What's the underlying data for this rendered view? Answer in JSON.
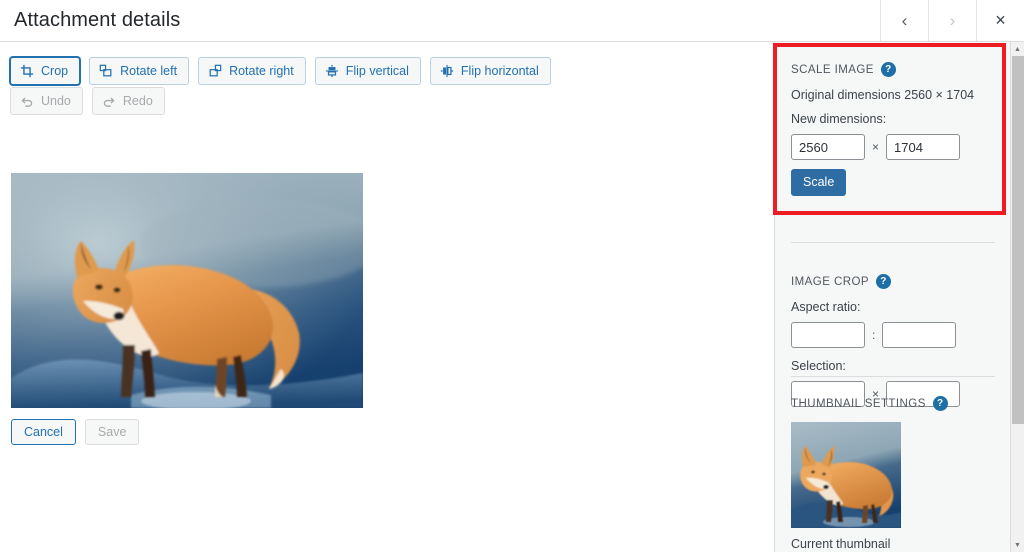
{
  "header": {
    "title": "Attachment details",
    "nav": {
      "prev_label": "‹",
      "prev_name": "previous-attachment",
      "next_label": "›",
      "next_name": "next-attachment",
      "close_label": "×",
      "close_name": "close-dialog"
    }
  },
  "editor": {
    "tools": [
      {
        "label": "Crop",
        "icon": "crop-icon",
        "state": "focused"
      },
      {
        "label": "Rotate left",
        "icon": "rotate-left-icon",
        "state": "enabled"
      },
      {
        "label": "Rotate right",
        "icon": "rotate-right-icon",
        "state": "enabled"
      },
      {
        "label": "Flip vertical",
        "icon": "flip-vertical-icon",
        "state": "enabled"
      },
      {
        "label": "Flip horizontal",
        "icon": "flip-horizontal-icon",
        "state": "enabled"
      }
    ],
    "history": [
      {
        "label": "Undo",
        "icon": "undo-icon",
        "state": "disabled"
      },
      {
        "label": "Redo",
        "icon": "redo-icon",
        "state": "disabled"
      }
    ],
    "image_alt": "Red fox standing on snow at sunset",
    "actions": {
      "cancel_label": "Cancel",
      "save_label": "Save",
      "save_state": "disabled"
    }
  },
  "sidebar": {
    "scale_image": {
      "title": "SCALE IMAGE",
      "help_label": "?",
      "original_dimensions_text": "Original dimensions 2560 × 1704",
      "new_dimensions_label": "New dimensions:",
      "width_value": "2560",
      "height_value": "1704",
      "times_symbol": "×",
      "scale_button_label": "Scale",
      "highlighted": true,
      "highlight_color": "#ee1c25"
    },
    "image_crop": {
      "title": "IMAGE CROP",
      "help_label": "?",
      "aspect_ratio_label": "Aspect ratio:",
      "aspect_width_value": "",
      "aspect_height_value": "",
      "ratio_symbol": ":",
      "selection_label": "Selection:",
      "selection_width_value": "",
      "selection_height_value": "",
      "times_symbol": "×"
    },
    "thumbnail_settings": {
      "title": "THUMBNAIL SETTINGS",
      "help_label": "?",
      "caption": "Current thumbnail"
    }
  },
  "colors": {
    "accent": "#2271b1",
    "primary_button": "#2e6da4",
    "highlight": "#ee1c25",
    "help_icon": "#1d6fa5",
    "sidebar_bg": "#f6f7f7"
  }
}
